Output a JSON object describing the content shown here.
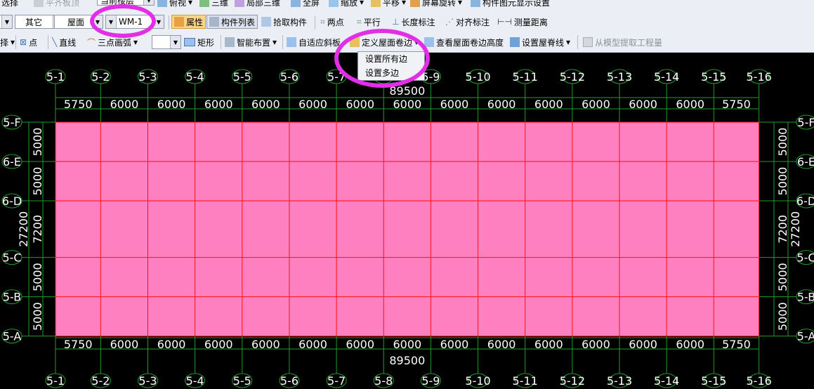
{
  "toolbar_top": {
    "items": [
      "选择",
      "平齐板顶",
      "当前楼层",
      "俯视",
      "三维",
      "局部三维",
      "全屏",
      "缩放",
      "平移",
      "屏幕旋转",
      "构件图元显示设置"
    ]
  },
  "toolbar_mid": {
    "combo_category": "其它",
    "combo_type": "屋面",
    "combo_element": "WM-1",
    "btn_attributes": "属性",
    "btn_element_list": "构件列表",
    "btn_pick": "拾取构件",
    "btn_two_points": "两点",
    "btn_parallel": "平行",
    "btn_length_dim": "长度标注",
    "btn_align_dim": "对齐标注",
    "btn_measure": "测量距离"
  },
  "toolbar_bot": {
    "btn_select": "选择",
    "btn_point": "点",
    "btn_line": "直线",
    "combo_arc": "三点画弧",
    "btn_rect": "矩形",
    "btn_smart": "智能布置",
    "btn_adaptive_slope": "自适应斜板",
    "btn_define_edge": "定义屋面卷边",
    "btn_view_edge": "查看屋面卷边高度",
    "btn_ridge": "设置屋脊线",
    "btn_extract": "从模型提取工程量"
  },
  "dropdown": {
    "items": [
      "设置所有边",
      "设置多边"
    ]
  },
  "grid": {
    "x_axes": [
      "5-1",
      "5-2",
      "5-3",
      "5-4",
      "5-5",
      "5-6",
      "5-7",
      "5-8",
      "5-9",
      "5-10",
      "5-11",
      "5-12",
      "5-13",
      "5-14",
      "5-15",
      "5-16"
    ],
    "x_spacings": [
      5750,
      6000,
      6000,
      6000,
      6000,
      6000,
      6000,
      6000,
      6000,
      6000,
      6000,
      6000,
      6000,
      6000,
      5750
    ],
    "x_total": "89500",
    "y_axes": [
      "5-F",
      "6-E",
      "6-D",
      "5-C",
      "5-B",
      "5-A"
    ],
    "y_spacings": [
      5000,
      5000,
      7200,
      5000,
      5000
    ],
    "y_total": "27200"
  },
  "colors": {
    "slab_fill": "#ff80c0",
    "grid_line": "#ff1010",
    "dim_line": "#1f9d2a",
    "dim_text": "#ffffff",
    "highlight": "#e32ee8",
    "background": "#000000"
  }
}
